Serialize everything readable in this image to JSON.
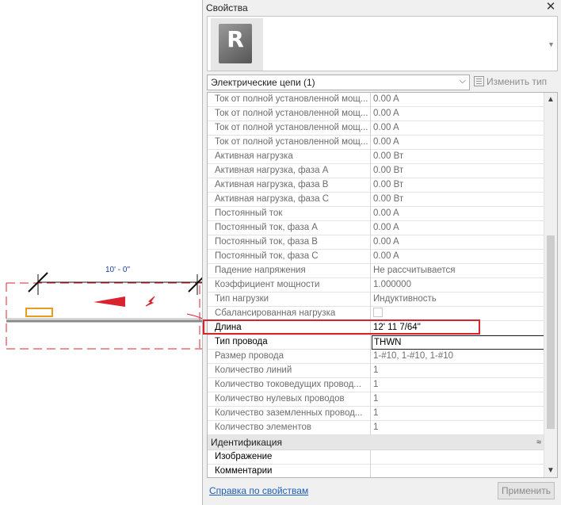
{
  "canvas": {
    "dimension_label": "10' - 0\""
  },
  "panel": {
    "title": "Свойства",
    "close_glyph": "✕",
    "type_icon_letter": "R",
    "category_select": "Электрические цепи (1)",
    "edit_type_label": "Изменить тип",
    "rows": [
      {
        "label": "Ток от полной установленной мощ...",
        "value": "0.00 A"
      },
      {
        "label": "Ток от полной установленной мощ...",
        "value": "0.00 A"
      },
      {
        "label": "Ток от полной установленной мощ...",
        "value": "0.00 A"
      },
      {
        "label": "Ток от полной установленной мощ...",
        "value": "0.00 A"
      },
      {
        "label": "Активная нагрузка",
        "value": "0.00 Вт"
      },
      {
        "label": "Активная нагрузка, фаза A",
        "value": "0.00 Вт"
      },
      {
        "label": "Активная нагрузка, фаза B",
        "value": "0.00 Вт"
      },
      {
        "label": "Активная нагрузка, фаза C",
        "value": "0.00 Вт"
      },
      {
        "label": "Постоянный ток",
        "value": "0.00 A"
      },
      {
        "label": "Постоянный ток, фаза A",
        "value": "0.00 A"
      },
      {
        "label": "Постоянный ток, фаза B",
        "value": "0.00 A"
      },
      {
        "label": "Постоянный ток, фаза C",
        "value": "0.00 A"
      },
      {
        "label": "Падение напряжения",
        "value": "Не рассчитывается"
      },
      {
        "label": "Коэффициент мощности",
        "value": "1.000000"
      },
      {
        "label": "Тип нагрузки",
        "value": "Индуктивность"
      },
      {
        "label": "Сбалансированная нагрузка",
        "value": ""
      },
      {
        "label": "Длина",
        "value": "12'  11 7/64\""
      },
      {
        "label": "Тип провода",
        "value": "THWN"
      },
      {
        "label": "Размер провода",
        "value": "1-#10, 1-#10, 1-#10"
      },
      {
        "label": "Количество линий",
        "value": "1"
      },
      {
        "label": "Количество токоведущих провод...",
        "value": "1"
      },
      {
        "label": "Количество нулевых проводов",
        "value": "1"
      },
      {
        "label": "Количество заземленных провод...",
        "value": "1"
      },
      {
        "label": "Количество элементов",
        "value": "1"
      }
    ],
    "group": {
      "label": "Идентификация",
      "chevron": "≈"
    },
    "group_rows": [
      {
        "label": "Изображение",
        "value": ""
      },
      {
        "label": "Комментарии",
        "value": ""
      }
    ],
    "help_link": "Справка по свойствам",
    "apply_button": "Применить",
    "scroll_up": "▲",
    "scroll_down": "▼",
    "dropdown_arrow": "⌵",
    "type_dropdown_arrow": "▼"
  }
}
